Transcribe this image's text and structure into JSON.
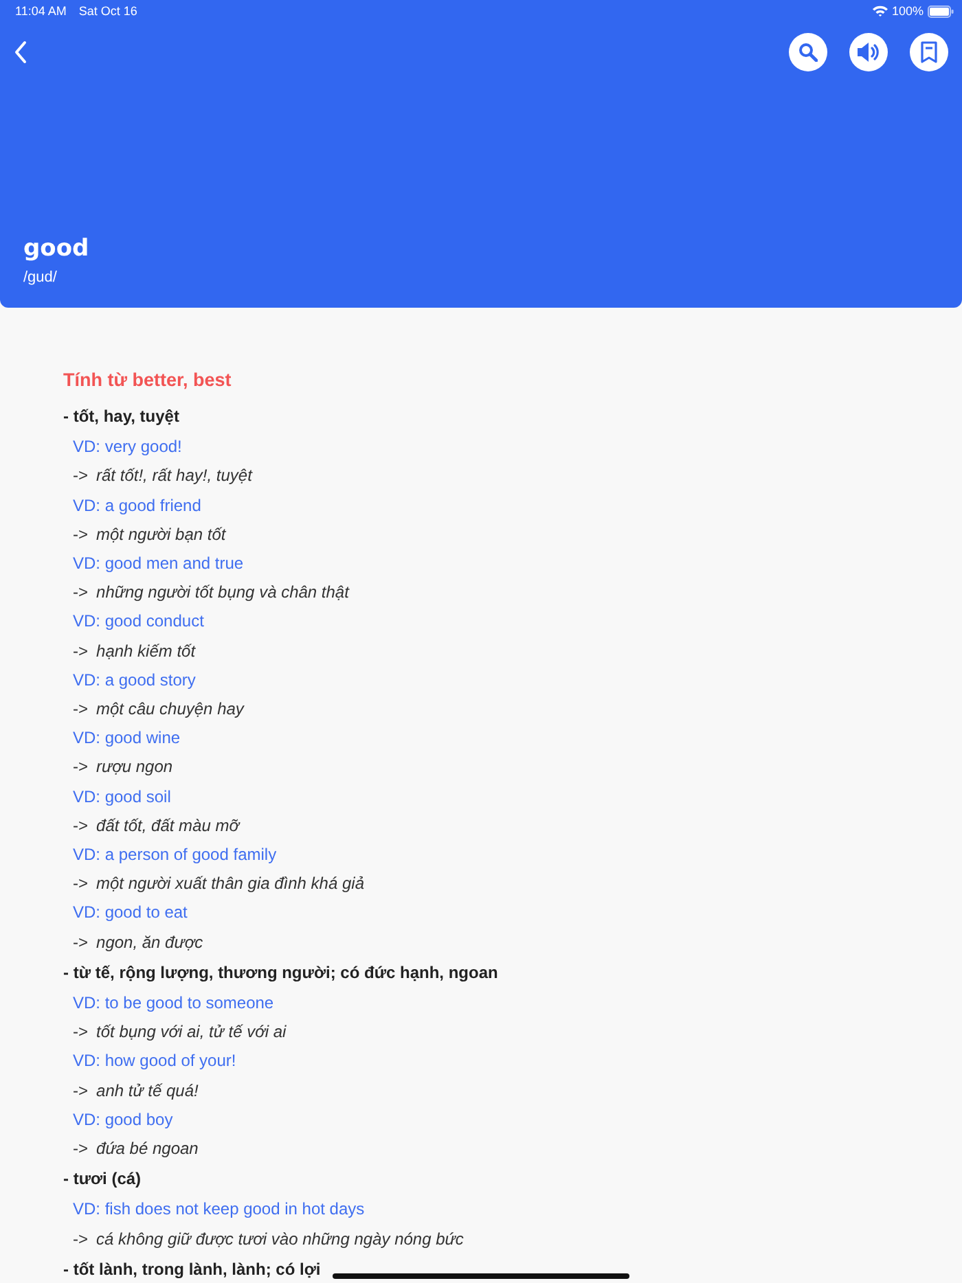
{
  "status_bar": {
    "time": "11:04 AM",
    "date": "Sat Oct 16",
    "battery": "100%"
  },
  "header": {
    "word": "good",
    "pronunciation": "/gud/"
  },
  "entry": {
    "heading": "Tính từ better,  best",
    "lines": [
      {
        "kind": "sense",
        "text": "- tốt, hay, tuyệt"
      },
      {
        "kind": "example",
        "text": "VD: very good!"
      },
      {
        "kind": "translation",
        "arrow": "->",
        "text": "rất tốt!, rất hay!, tuyệt"
      },
      {
        "kind": "example",
        "text": "VD: a good friend"
      },
      {
        "kind": "translation",
        "arrow": "->",
        "text": "một người bạn tốt"
      },
      {
        "kind": "example",
        "text": "VD: good men and true"
      },
      {
        "kind": "translation",
        "arrow": "->",
        "text": "những người tốt bụng và chân thật"
      },
      {
        "kind": "example",
        "text": "VD: good conduct"
      },
      {
        "kind": "translation",
        "arrow": "->",
        "text": "hạnh kiếm tốt"
      },
      {
        "kind": "example",
        "text": "VD: a good story"
      },
      {
        "kind": "translation",
        "arrow": "->",
        "text": "một câu chuyện hay"
      },
      {
        "kind": "example",
        "text": "VD: good wine"
      },
      {
        "kind": "translation",
        "arrow": "->",
        "text": "rượu ngon"
      },
      {
        "kind": "example",
        "text": "VD: good soil"
      },
      {
        "kind": "translation",
        "arrow": "->",
        "text": "đất tốt, đất màu mỡ"
      },
      {
        "kind": "example",
        "text": "VD: a person of good family"
      },
      {
        "kind": "translation",
        "arrow": "->",
        "text": "một người xuất thân gia đình khá giả"
      },
      {
        "kind": "example",
        "text": "VD: good to eat"
      },
      {
        "kind": "translation",
        "arrow": "->",
        "text": "ngon, ăn được"
      },
      {
        "kind": "sense",
        "text": "- từ tế, rộng lượng, thương người; có đức hạnh, ngoan"
      },
      {
        "kind": "example",
        "text": "VD: to be good to someone"
      },
      {
        "kind": "translation",
        "arrow": "->",
        "text": "tốt bụng với ai, tử tế với ai"
      },
      {
        "kind": "example",
        "text": "VD: how good of your!"
      },
      {
        "kind": "translation",
        "arrow": "->",
        "text": "anh tử tế quá!"
      },
      {
        "kind": "example",
        "text": "VD: good boy"
      },
      {
        "kind": "translation",
        "arrow": "->",
        "text": "đứa bé ngoan"
      },
      {
        "kind": "sense",
        "text": "- tươi (cá)"
      },
      {
        "kind": "example",
        "text": "VD: fish does not keep good in hot days"
      },
      {
        "kind": "translation",
        "arrow": "->",
        "text": "cá không giữ được tươi vào những ngày nóng bức"
      },
      {
        "kind": "sense",
        "text": "- tốt lành, trong lành, lành; có lợi"
      }
    ]
  }
}
